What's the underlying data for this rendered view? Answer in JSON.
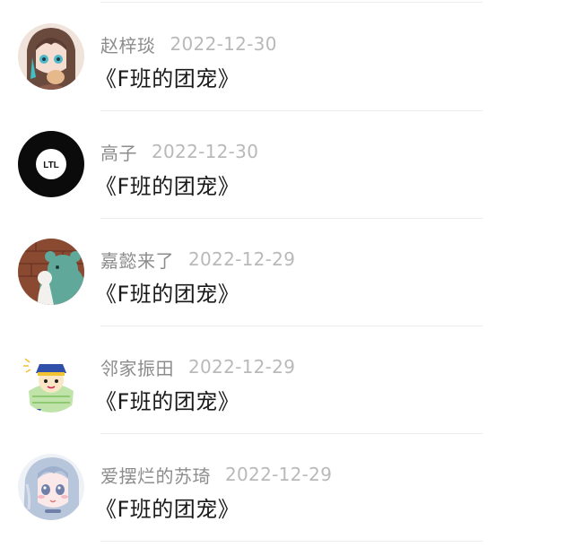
{
  "comments": [
    {
      "user": "赵梓琰",
      "date": "2022-12-30",
      "text": "《F班的团宠》",
      "avatar_icon": "anime-girl-avatar-icon"
    },
    {
      "user": "高子",
      "date": "2022-12-30",
      "text": "《F班的团宠》",
      "avatar_icon": "ltl-logo-avatar-icon",
      "avatar_text": "LTL"
    },
    {
      "user": "嘉懿来了",
      "date": "2022-12-29",
      "text": "《F班的团宠》",
      "avatar_icon": "bear-hoodie-avatar-icon"
    },
    {
      "user": "邻家振田",
      "date": "2022-12-29",
      "text": "《F班的团宠》",
      "avatar_icon": "cartoon-character-avatar-icon"
    },
    {
      "user": "爱摆烂的苏琦",
      "date": "2022-12-29",
      "text": "《F班的团宠》",
      "avatar_icon": "anime-girl-blue-hair-avatar-icon"
    }
  ],
  "colors": {
    "username": "#8c8c8c",
    "date": "#b9b9b9",
    "text": "#1a1a1a",
    "divider": "#ececec"
  }
}
